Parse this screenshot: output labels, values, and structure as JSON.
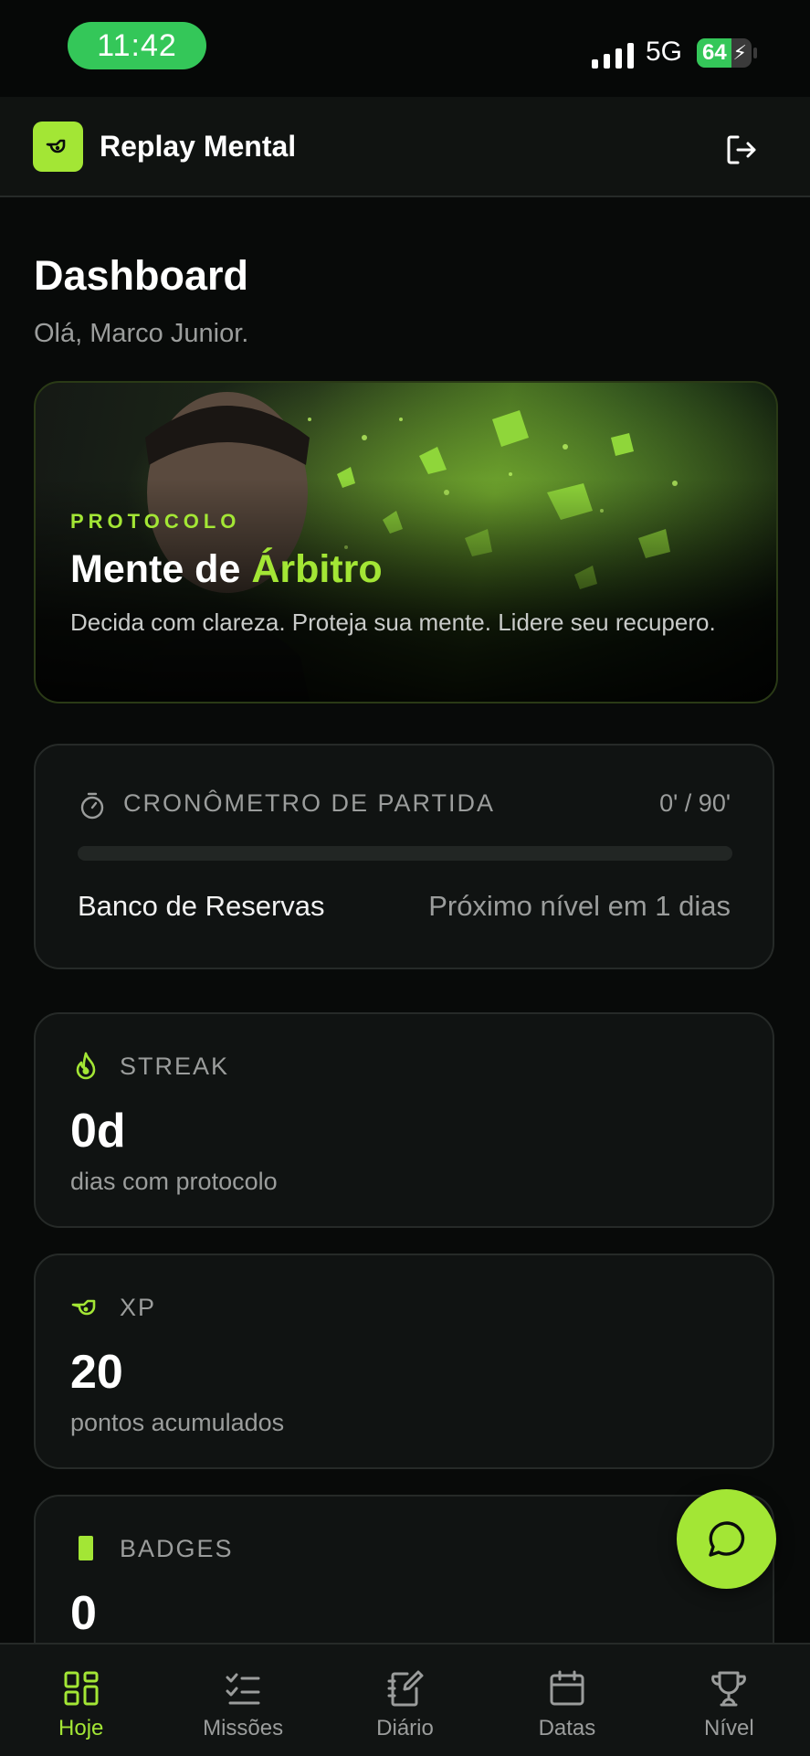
{
  "status_bar": {
    "time": "11:42",
    "network": "5G",
    "battery": "64",
    "battery_level": 0.64
  },
  "header": {
    "app_name": "Replay Mental"
  },
  "page": {
    "title": "Dashboard",
    "greeting": "Olá, Marco Junior."
  },
  "hero": {
    "kicker": "PROTOCOLO",
    "title_main": "Mente de ",
    "title_accent": "Árbitro",
    "description": "Decida com clareza. Proteja sua mente. Lidere seu recupero."
  },
  "timer": {
    "label": "CRONÔMETRO DE PARTIDA",
    "value": "0' / 90'",
    "progress": 0,
    "level": "Banco de Reservas",
    "next_level": "Próximo nível em 1 dias"
  },
  "stats": [
    {
      "label": "STREAK",
      "value": "0d",
      "sub": "dias com protocolo",
      "icon": "flame-icon"
    },
    {
      "label": "XP",
      "value": "20",
      "sub": "pontos acumulados",
      "icon": "whistle-icon"
    },
    {
      "label": "BADGES",
      "value": "0",
      "sub": "",
      "icon": "card-icon"
    }
  ],
  "nav": [
    {
      "label": "Hoje",
      "icon": "grid-icon",
      "active": true
    },
    {
      "label": "Missões",
      "icon": "checklist-icon",
      "active": false
    },
    {
      "label": "Diário",
      "icon": "notebook-icon",
      "active": false
    },
    {
      "label": "Datas",
      "icon": "calendar-icon",
      "active": false
    },
    {
      "label": "Nível",
      "icon": "trophy-icon",
      "active": false
    }
  ],
  "colors": {
    "accent": "#a3e635",
    "background": "#080a09",
    "card": "#101312",
    "muted": "#9b9d9c",
    "status_green": "#34c759"
  }
}
